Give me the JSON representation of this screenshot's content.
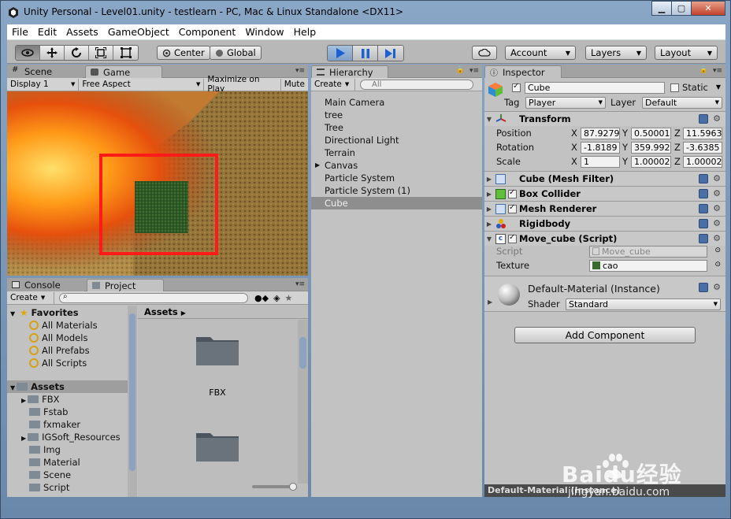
{
  "window": {
    "title": "Unity Personal - Level01.unity - testlearn - PC, Mac & Linux Standalone <DX11>",
    "controls": [
      "minimize",
      "maximize",
      "close"
    ]
  },
  "menu": [
    "File",
    "Edit",
    "Assets",
    "GameObject",
    "Component",
    "Window",
    "Help"
  ],
  "toolbar": {
    "transform_tools": [
      "hand-eye",
      "move",
      "rotate",
      "scale",
      "rect"
    ],
    "pivot_label": "Center",
    "space_label": "Global",
    "account_label": "Account",
    "layers_label": "Layers",
    "layout_label": "Layout",
    "play_state": "playing"
  },
  "scene_panel": {
    "tabs": [
      "Scene",
      "Game"
    ],
    "active_tab": "Game",
    "display": "Display 1",
    "aspect": "Free Aspect",
    "maximize": "Maximize on Play",
    "mute": "Mute",
    "highlight_color": "#ff1a1a"
  },
  "hierarchy": {
    "tab": "Hierarchy",
    "create": "Create",
    "search_placeholder": "All",
    "items": [
      "Main Camera",
      "tree",
      "Tree",
      "Directional Light",
      "Terrain",
      "Canvas",
      "Particle System",
      "Particle System (1)",
      "Cube"
    ],
    "selected": "Cube"
  },
  "inspector": {
    "tab": "Inspector",
    "object_name": "Cube",
    "static_label": "Static",
    "tag_label": "Tag",
    "tag_value": "Player",
    "layer_label": "Layer",
    "layer_value": "Default",
    "transform": {
      "title": "Transform",
      "position_label": "Position",
      "rotation_label": "Rotation",
      "scale_label": "Scale",
      "position": [
        "87.9279",
        "0.50001",
        "11.5963"
      ],
      "rotation": [
        "-1.8189",
        "359.992",
        "-3.6385"
      ],
      "scale": [
        "1",
        "1.00002",
        "1.00002"
      ]
    },
    "axes": [
      "X",
      "Y",
      "Z"
    ],
    "components": [
      "Cube (Mesh Filter)",
      "Box Collider",
      "Mesh Renderer",
      "Rigidbody",
      "Move_cube (Script)"
    ],
    "script_label": "Script",
    "script_value": "Move_cube",
    "texture_label": "Texture",
    "texture_value": "cao",
    "material_name": "Default-Material (Instance)",
    "shader_label": "Shader",
    "shader_value": "Standard",
    "add_component": "Add Component",
    "preview_label": "Default-Material (Instance)"
  },
  "project_panel": {
    "tabs": [
      "Console",
      "Project"
    ],
    "active_tab": "Project",
    "create": "Create",
    "favorites_label": "Favorites",
    "favorites": [
      "All Materials",
      "All Models",
      "All Prefabs",
      "All Scripts"
    ],
    "assets_label": "Assets",
    "folders": [
      "FBX",
      "Fstab",
      "fxmaker",
      "IGSoft_Resources",
      "Img",
      "Material",
      "Scene",
      "Script"
    ],
    "breadcrumb": "Assets",
    "grid_items": [
      "FBX",
      ""
    ]
  },
  "watermark": {
    "brand": "Baidu经验",
    "url": "jingyan.baidu.com"
  }
}
